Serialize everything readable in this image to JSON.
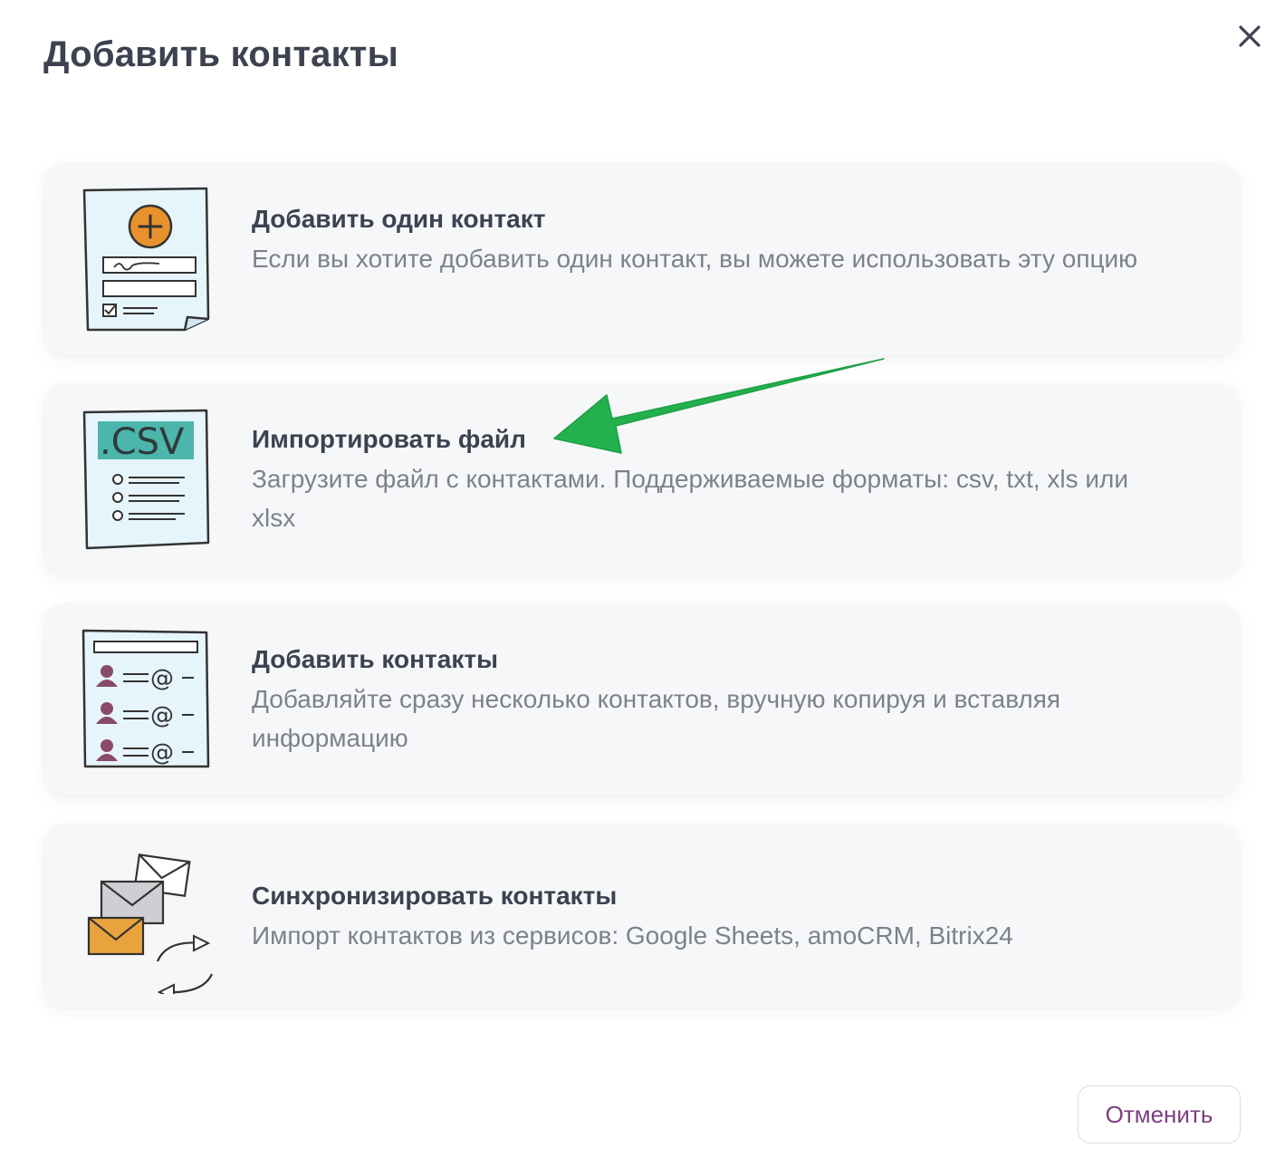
{
  "modal": {
    "title": "Добавить контакты"
  },
  "options": [
    {
      "title": "Добавить один контакт",
      "description": "Если вы хотите добавить один контакт, вы можете использовать эту опцию",
      "icon": "contact-form-icon"
    },
    {
      "title": "Импортировать файл",
      "description": "Загрузите файл с контактами. Поддерживаемые форматы: csv, txt, xls или xlsx",
      "icon": "csv-file-icon",
      "icon_label": ".CSV"
    },
    {
      "title": "Добавить контакты",
      "description": "Добавляйте сразу несколько контактов, вручную копируя и вставляя информацию",
      "icon": "contact-list-icon",
      "icon_label": "@"
    },
    {
      "title": "Синхронизировать контакты",
      "description": "Импорт контактов из сервисов: Google Sheets, amoCRM, Bitrix24",
      "icon": "sync-mail-icon"
    }
  ],
  "footer": {
    "cancel_label": "Отменить"
  },
  "annotation": {
    "arrow_color": "#22b14c",
    "points_to": "options.1.title"
  },
  "colors": {
    "title_text": "#3d4150",
    "description_text": "#7d818c",
    "card_background": "#f6f7f9",
    "cancel_text": "#7b3e80",
    "accent_orange": "#e8922d",
    "accent_teal": "#4db6ac",
    "accent_plum": "#8a4a6b",
    "icon_paper": "#e6f4fb"
  }
}
